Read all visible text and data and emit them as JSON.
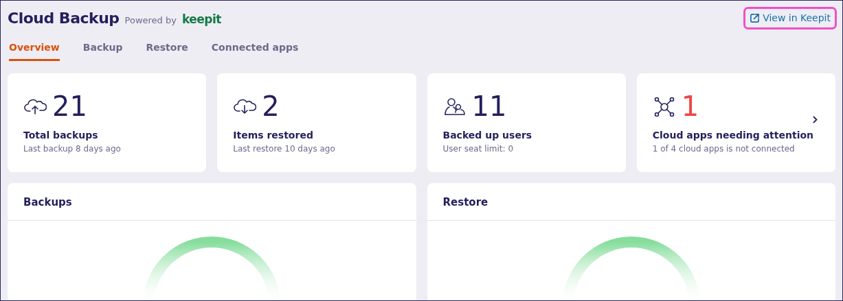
{
  "header": {
    "title": "Cloud Backup",
    "powered_by": "Powered by",
    "logo": "keepit",
    "link": "View in Keepit"
  },
  "tabs": [
    {
      "label": "Overview",
      "selected": true
    },
    {
      "label": "Backup",
      "selected": false
    },
    {
      "label": "Restore",
      "selected": false
    },
    {
      "label": "Connected apps",
      "selected": false
    }
  ],
  "stats": [
    {
      "kind": "upload",
      "value": "21",
      "alert": false,
      "title": "Total backups",
      "subtitle": "Last backup 8 days ago",
      "has_arrow": false
    },
    {
      "kind": "download",
      "value": "2",
      "alert": false,
      "title": "Items restored",
      "subtitle": "Last restore 10 days ago",
      "has_arrow": false
    },
    {
      "kind": "users",
      "value": "11",
      "alert": false,
      "title": "Backed up users",
      "subtitle": "User seat limit: 0",
      "has_arrow": false
    },
    {
      "kind": "apps",
      "value": "1",
      "alert": true,
      "title": "Cloud apps needing attention",
      "subtitle": "1 of 4 cloud apps is not connected",
      "has_arrow": true
    }
  ],
  "panels": [
    {
      "title": "Backups"
    },
    {
      "title": "Restore"
    }
  ]
}
